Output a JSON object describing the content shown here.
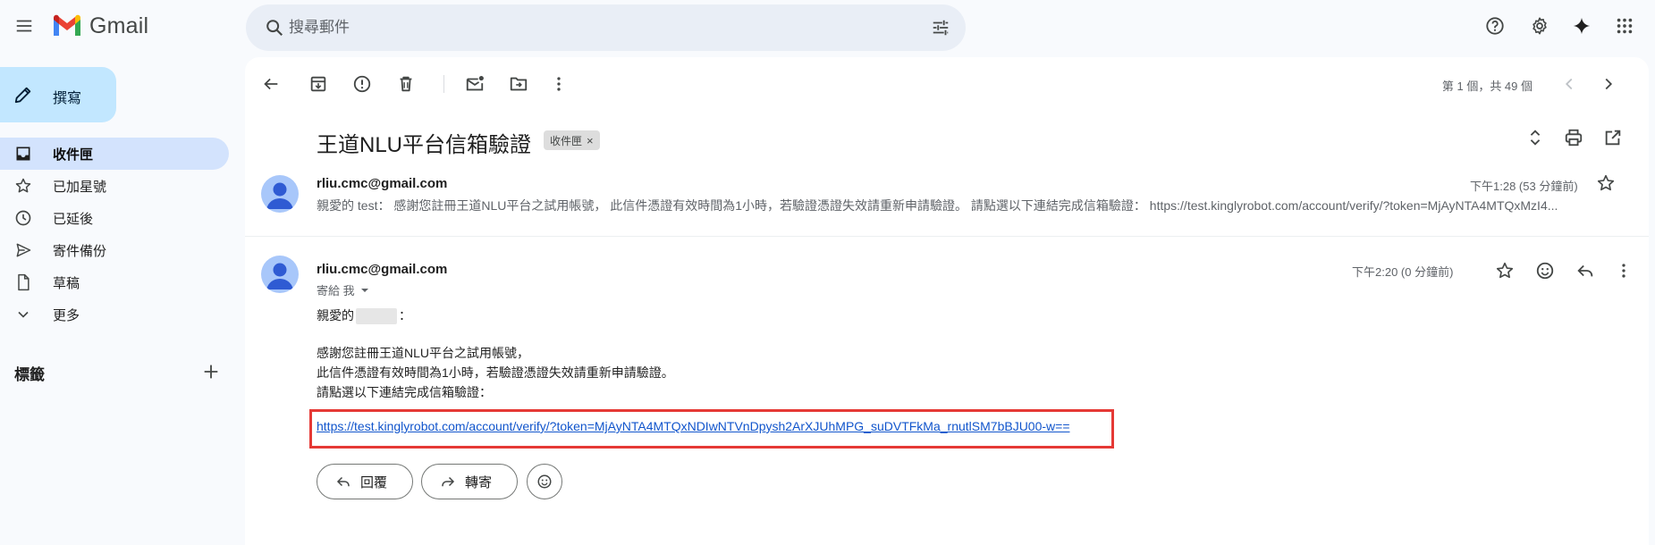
{
  "app": {
    "name": "Gmail"
  },
  "search": {
    "placeholder": "搜尋郵件"
  },
  "compose": {
    "label": "撰寫"
  },
  "sidebar": {
    "items": [
      {
        "label": "收件匣",
        "icon": "inbox-icon",
        "active": true
      },
      {
        "label": "已加星號",
        "icon": "star-icon",
        "active": false
      },
      {
        "label": "已延後",
        "icon": "clock-icon",
        "active": false
      },
      {
        "label": "寄件備份",
        "icon": "send-icon",
        "active": false
      },
      {
        "label": "草稿",
        "icon": "draft-icon",
        "active": false
      },
      {
        "label": "更多",
        "icon": "chevron-down-icon",
        "active": false
      }
    ],
    "labels_title": "標籤"
  },
  "pager": {
    "text": "第 1 個，共 49 個"
  },
  "thread": {
    "subject": "王道NLU平台信箱驗證",
    "label_chip": "收件匣",
    "label_chip_close": "×"
  },
  "message1": {
    "sender": "rliu.cmc@gmail.com",
    "time": "下午1:28 (53 分鐘前)",
    "snippet": "親愛的 test： 感謝您註冊王道NLU平台之試用帳號， 此信件憑證有效時間為1小時，若驗證憑證失效請重新申請驗證。 請點選以下連結完成信箱驗證： https://test.kinglyrobot.com/account/verify/?token=MjAyNTA4MTQxMzI4..."
  },
  "message2": {
    "sender": "rliu.cmc@gmail.com",
    "time": "下午2:20 (0 分鐘前)",
    "recipient": "寄給 我",
    "greeting_prefix": "親愛的",
    "greeting_suffix": "：",
    "body_line1": "感謝您註冊王道NLU平台之試用帳號，",
    "body_line2": "此信件憑證有效時間為1小時，若驗證憑證失效請重新申請驗證。",
    "body_line3": "請點選以下連結完成信箱驗證：",
    "link": "https://test.kinglyrobot.com/account/verify/?token=MjAyNTA4MTQxNDIwNTVnDpysh2ArXJUhMPG_suDVTFkMa_rnutlSM7bBJU00-w=="
  },
  "actions": {
    "reply_label": "回覆",
    "forward_label": "轉寄"
  },
  "colors": {
    "accent": "#c2e7ff",
    "active_nav": "#d3e3fd",
    "highlight_box": "#e53935",
    "link": "#1155cc"
  }
}
